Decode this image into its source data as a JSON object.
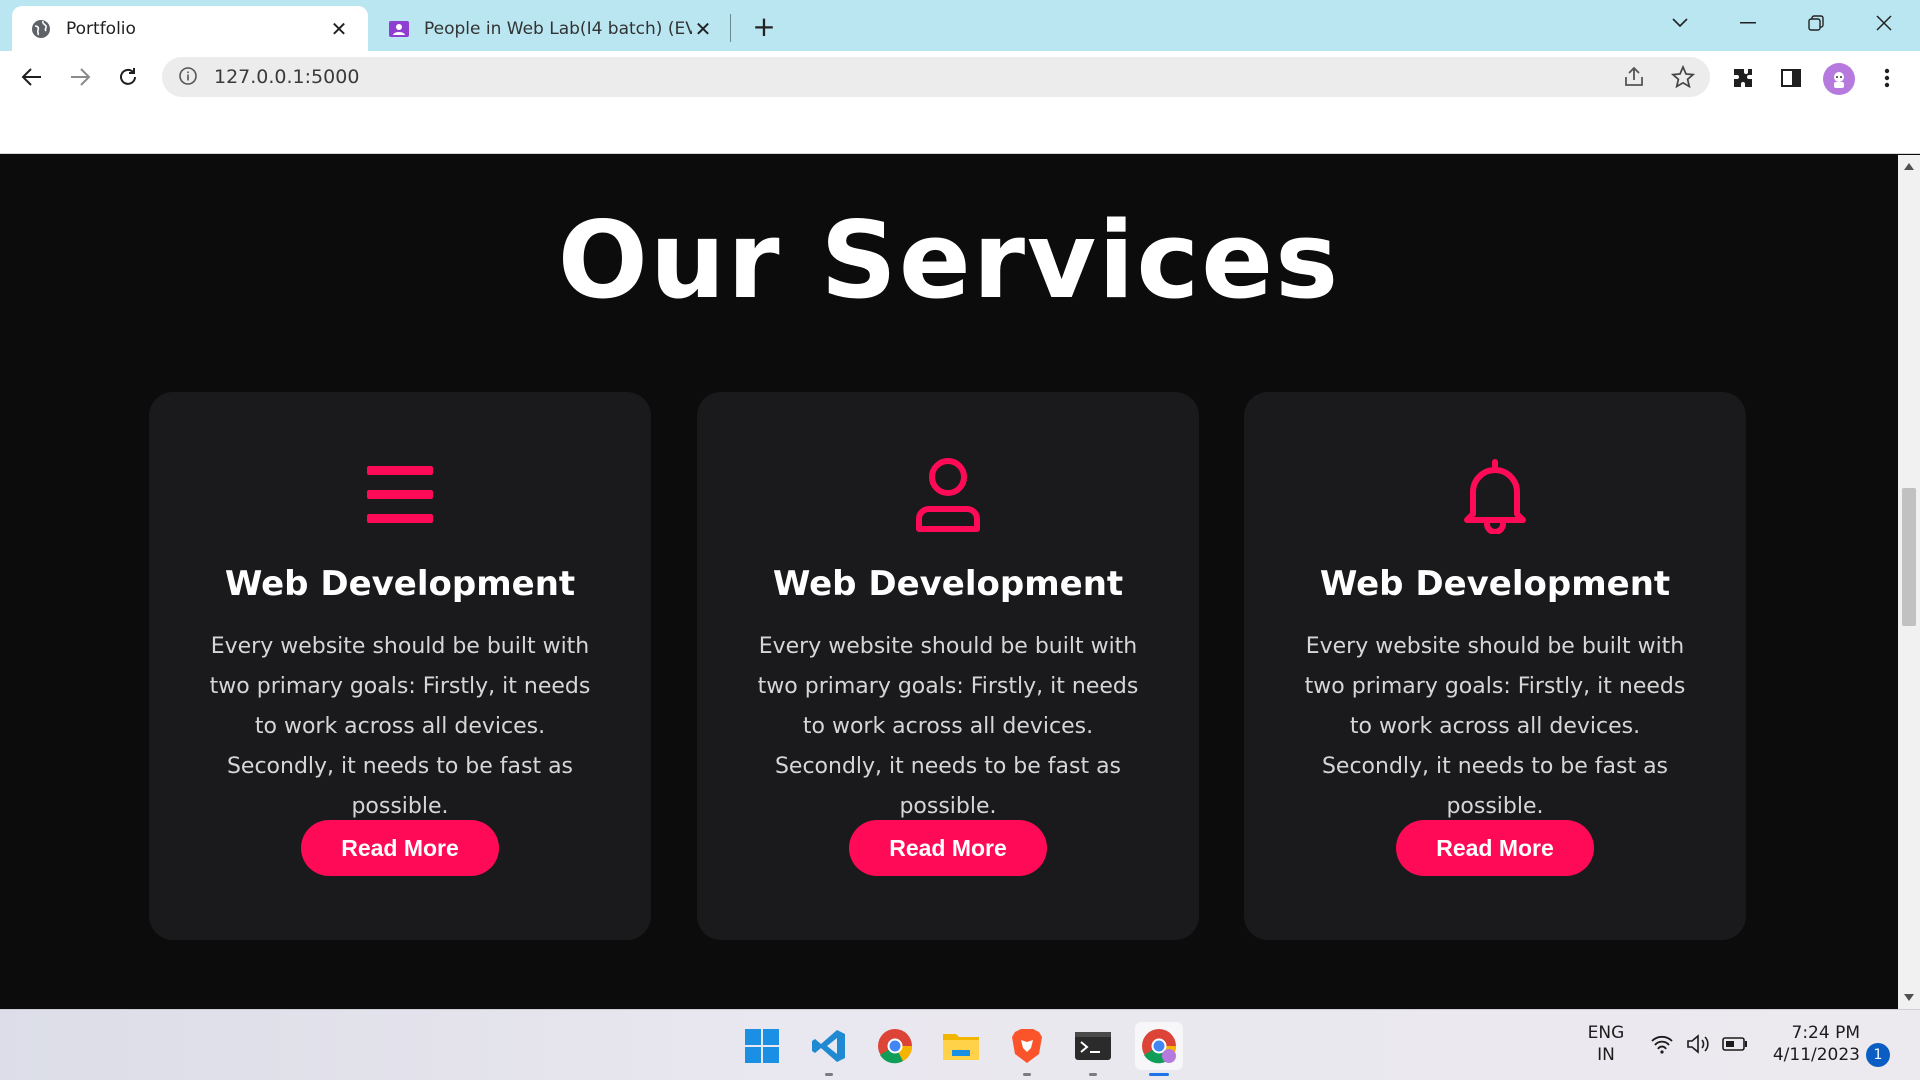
{
  "browser": {
    "tabs": [
      {
        "title": "Portfolio",
        "active": true
      },
      {
        "title": "People in Web Lab(I4 batch) (EVE",
        "active": false
      }
    ],
    "url": "127.0.0.1:5000"
  },
  "page": {
    "section_title": "Our Services",
    "accent_color": "#ff0a57",
    "cards": [
      {
        "icon": "menu-bars-icon",
        "title": "Web Development",
        "text": "Every website should be built with two primary goals: Firstly, it needs to work across all devices. Secondly, it needs to be fast as possible.",
        "button": "Read More"
      },
      {
        "icon": "user-icon",
        "title": "Web Development",
        "text": "Every website should be built with two primary goals: Firstly, it needs to work across all devices. Secondly, it needs to be fast as possible.",
        "button": "Read More"
      },
      {
        "icon": "bell-icon",
        "title": "Web Development",
        "text": "Every website should be built with two primary goals: Firstly, it needs to work across all devices. Secondly, it needs to be fast as possible.",
        "button": "Read More"
      }
    ]
  },
  "taskbar": {
    "apps": [
      "windows-start",
      "vscode",
      "chrome",
      "file-explorer",
      "brave",
      "terminal",
      "chrome-profile"
    ],
    "language": "ENG",
    "region": "IN",
    "time": "7:24 PM",
    "date": "4/11/2023",
    "notifications": "1"
  }
}
